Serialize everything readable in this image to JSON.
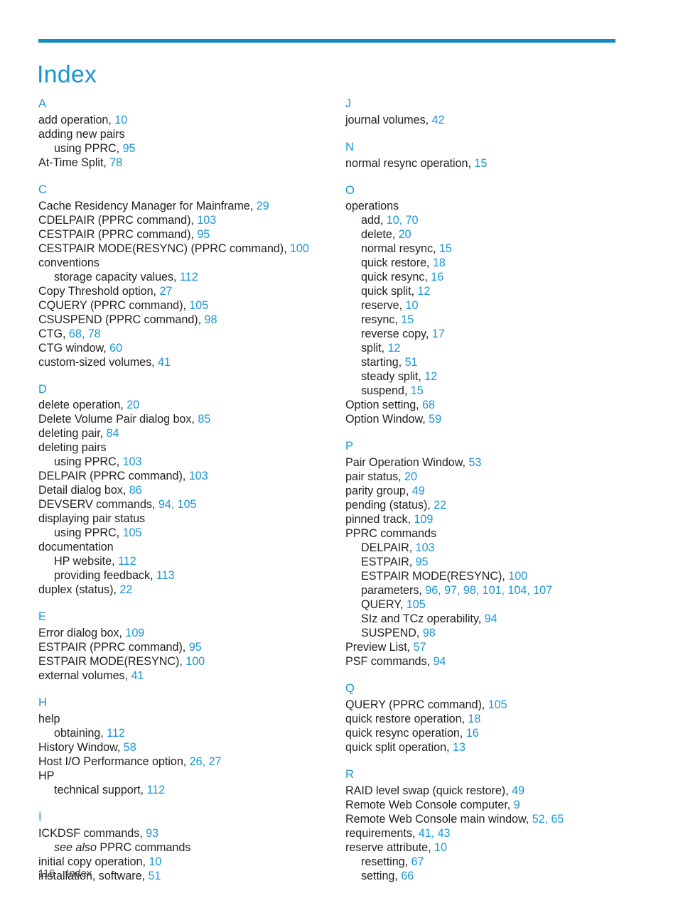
{
  "document": {
    "title": "Index",
    "accent_rule_color": "#0f8ac4",
    "title_color": "#1996d3",
    "page_number_color": "#1996d3",
    "text_color": "#231f20"
  },
  "footer": {
    "page_number": "116",
    "label": "Index"
  },
  "columns": [
    {
      "name": "left-column",
      "sections": [
        {
          "letter": "A",
          "entries": [
            {
              "text": "add operation, ",
              "pages": "10",
              "level": 0
            },
            {
              "text": "adding new pairs",
              "pages": "",
              "level": 0
            },
            {
              "text": "using PPRC, ",
              "pages": "95",
              "level": 1
            },
            {
              "text": "At-Time Split, ",
              "pages": "78",
              "level": 0
            }
          ]
        },
        {
          "letter": "C",
          "entries": [
            {
              "text": "Cache Residency Manager for Mainframe, ",
              "pages": "29",
              "level": 0
            },
            {
              "text": "CDELPAIR (PPRC command), ",
              "pages": "103",
              "level": 0
            },
            {
              "text": "CESTPAIR (PPRC command), ",
              "pages": "95",
              "level": 0
            },
            {
              "text": "CESTPAIR MODE(RESYNC) (PPRC command), ",
              "pages": "100",
              "level": 0
            },
            {
              "text": "conventions",
              "pages": "",
              "level": 0
            },
            {
              "text": "storage capacity values, ",
              "pages": "112",
              "level": 1
            },
            {
              "text": "Copy Threshold option, ",
              "pages": "27",
              "level": 0
            },
            {
              "text": "CQUERY (PPRC command), ",
              "pages": "105",
              "level": 0
            },
            {
              "text": "CSUSPEND (PPRC command), ",
              "pages": "98",
              "level": 0
            },
            {
              "text": "CTG, ",
              "pages": "68, 78",
              "level": 0
            },
            {
              "text": "CTG window, ",
              "pages": "60",
              "level": 0
            },
            {
              "text": "custom-sized volumes, ",
              "pages": "41",
              "level": 0
            }
          ]
        },
        {
          "letter": "D",
          "entries": [
            {
              "text": "delete operation, ",
              "pages": "20",
              "level": 0
            },
            {
              "text": "Delete Volume Pair dialog box, ",
              "pages": "85",
              "level": 0
            },
            {
              "text": "deleting pair, ",
              "pages": "84",
              "level": 0
            },
            {
              "text": "deleting pairs",
              "pages": "",
              "level": 0
            },
            {
              "text": "using PPRC, ",
              "pages": "103",
              "level": 1
            },
            {
              "text": "DELPAIR (PPRC command), ",
              "pages": "103",
              "level": 0
            },
            {
              "text": "Detail dialog box, ",
              "pages": "86",
              "level": 0
            },
            {
              "text": "DEVSERV commands, ",
              "pages": "94, 105",
              "level": 0
            },
            {
              "text": "displaying pair status",
              "pages": "",
              "level": 0
            },
            {
              "text": "using PPRC, ",
              "pages": "105",
              "level": 1
            },
            {
              "text": "documentation",
              "pages": "",
              "level": 0
            },
            {
              "text": "HP website, ",
              "pages": "112",
              "level": 1
            },
            {
              "text": "providing feedback, ",
              "pages": "113",
              "level": 1
            },
            {
              "text": "duplex (status), ",
              "pages": "22",
              "level": 0
            }
          ]
        },
        {
          "letter": "E",
          "entries": [
            {
              "text": "Error dialog box, ",
              "pages": "109",
              "level": 0
            },
            {
              "text": "ESTPAIR (PPRC command), ",
              "pages": "95",
              "level": 0
            },
            {
              "text": "ESTPAIR MODE(RESYNC), ",
              "pages": "100",
              "level": 0
            },
            {
              "text": "external volumes, ",
              "pages": "41",
              "level": 0
            }
          ]
        },
        {
          "letter": "H",
          "entries": [
            {
              "text": "help",
              "pages": "",
              "level": 0
            },
            {
              "text": "obtaining, ",
              "pages": "112",
              "level": 1
            },
            {
              "text": "History Window, ",
              "pages": "58",
              "level": 0
            },
            {
              "text": "Host I/O Performance option, ",
              "pages": "26, 27",
              "level": 0
            },
            {
              "text": "HP",
              "pages": "",
              "level": 0
            },
            {
              "text": "technical support, ",
              "pages": "112",
              "level": 1
            }
          ]
        },
        {
          "letter": "I",
          "entries": [
            {
              "text": "ICKDSF commands, ",
              "pages": "93",
              "level": 0
            },
            {
              "text": "see also",
              "after_italic": " PPRC commands",
              "pages": "",
              "level": 1,
              "italic_lead": true
            },
            {
              "text": "initial copy operation, ",
              "pages": "10",
              "level": 0
            },
            {
              "text": "installation, software, ",
              "pages": "51",
              "level": 0
            }
          ]
        }
      ]
    },
    {
      "name": "right-column",
      "sections": [
        {
          "letter": "J",
          "entries": [
            {
              "text": "journal volumes, ",
              "pages": "42",
              "level": 0
            }
          ]
        },
        {
          "letter": "N",
          "entries": [
            {
              "text": "normal resync operation, ",
              "pages": "15",
              "level": 0
            }
          ]
        },
        {
          "letter": "O",
          "entries": [
            {
              "text": "operations",
              "pages": "",
              "level": 0
            },
            {
              "text": "add, ",
              "pages": "10, 70",
              "level": 1
            },
            {
              "text": "delete, ",
              "pages": "20",
              "level": 1
            },
            {
              "text": "normal resync, ",
              "pages": "15",
              "level": 1
            },
            {
              "text": "quick restore, ",
              "pages": "18",
              "level": 1
            },
            {
              "text": "quick resync, ",
              "pages": "16",
              "level": 1
            },
            {
              "text": "quick split, ",
              "pages": "12",
              "level": 1
            },
            {
              "text": "reserve, ",
              "pages": "10",
              "level": 1
            },
            {
              "text": "resync, ",
              "pages": "15",
              "level": 1
            },
            {
              "text": "reverse copy, ",
              "pages": "17",
              "level": 1
            },
            {
              "text": "split, ",
              "pages": "12",
              "level": 1
            },
            {
              "text": "starting, ",
              "pages": "51",
              "level": 1
            },
            {
              "text": "steady split, ",
              "pages": "12",
              "level": 1
            },
            {
              "text": "suspend, ",
              "pages": "15",
              "level": 1
            },
            {
              "text": "Option setting, ",
              "pages": "68",
              "level": 0
            },
            {
              "text": "Option Window, ",
              "pages": "59",
              "level": 0
            }
          ]
        },
        {
          "letter": "P",
          "entries": [
            {
              "text": "Pair Operation Window, ",
              "pages": "53",
              "level": 0
            },
            {
              "text": "pair status, ",
              "pages": "20",
              "level": 0
            },
            {
              "text": "parity group, ",
              "pages": "49",
              "level": 0
            },
            {
              "text": "pending (status), ",
              "pages": "22",
              "level": 0
            },
            {
              "text": "pinned track, ",
              "pages": "109",
              "level": 0
            },
            {
              "text": "PPRC commands",
              "pages": "",
              "level": 0
            },
            {
              "text": "DELPAIR, ",
              "pages": "103",
              "level": 1
            },
            {
              "text": "ESTPAIR, ",
              "pages": "95",
              "level": 1
            },
            {
              "text": "ESTPAIR MODE(RESYNC), ",
              "pages": "100",
              "level": 1
            },
            {
              "text": "parameters, ",
              "pages": "96, 97, 98, 101, 104, 107",
              "level": 1
            },
            {
              "text": "QUERY, ",
              "pages": "105",
              "level": 1
            },
            {
              "text": "SIz and TCz operability, ",
              "pages": "94",
              "level": 1
            },
            {
              "text": "SUSPEND, ",
              "pages": "98",
              "level": 1
            },
            {
              "text": "Preview List, ",
              "pages": "57",
              "level": 0
            },
            {
              "text": "PSF commands, ",
              "pages": "94",
              "level": 0
            }
          ]
        },
        {
          "letter": "Q",
          "entries": [
            {
              "text": "QUERY (PPRC command), ",
              "pages": "105",
              "level": 0
            },
            {
              "text": "quick restore operation, ",
              "pages": "18",
              "level": 0
            },
            {
              "text": "quick resync operation, ",
              "pages": "16",
              "level": 0
            },
            {
              "text": "quick split operation, ",
              "pages": "13",
              "level": 0
            }
          ]
        },
        {
          "letter": "R",
          "entries": [
            {
              "text": "RAID level swap (quick restore), ",
              "pages": "49",
              "level": 0
            },
            {
              "text": "Remote Web Console computer, ",
              "pages": "9",
              "level": 0
            },
            {
              "text": "Remote Web Console main window, ",
              "pages": "52, 65",
              "level": 0
            },
            {
              "text": "requirements, ",
              "pages": "41, 43",
              "level": 0
            },
            {
              "text": "reserve attribute, ",
              "pages": "10",
              "level": 0
            },
            {
              "text": "resetting, ",
              "pages": "67",
              "level": 1
            },
            {
              "text": "setting, ",
              "pages": "66",
              "level": 1
            }
          ]
        }
      ]
    }
  ]
}
